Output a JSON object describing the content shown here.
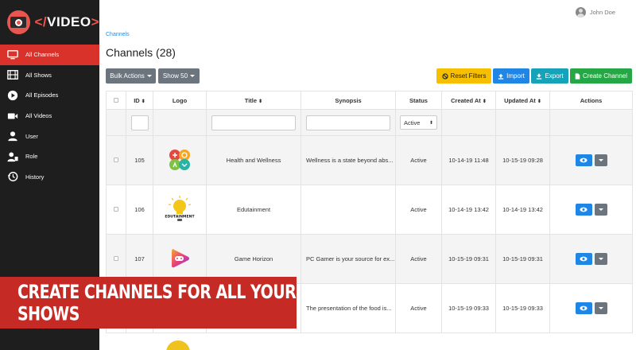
{
  "brand": {
    "logo_text_open": "</",
    "logo_text_word": "VIDEO",
    "logo_text_close": ">"
  },
  "sidebar": {
    "items": [
      {
        "label": "All Channels",
        "icon": "monitor-icon",
        "active": true
      },
      {
        "label": "All Shows",
        "icon": "film-icon"
      },
      {
        "label": "All Episodes",
        "icon": "play-circle-icon"
      },
      {
        "label": "All Videos",
        "icon": "video-camera-icon"
      },
      {
        "label": "User",
        "icon": "user-icon"
      },
      {
        "label": "Role",
        "icon": "user-tag-icon"
      },
      {
        "label": "History",
        "icon": "history-icon"
      }
    ]
  },
  "header": {
    "user_name": "John Doe"
  },
  "breadcrumb": "Channels",
  "page_title": "Channels (28)",
  "toolbar": {
    "bulk_actions": "Bulk Actions",
    "show_count": "Show 50",
    "reset_filters": "Reset Filters",
    "import": "Import",
    "export": "Export",
    "create_channel": "Create Channel"
  },
  "table": {
    "columns": [
      "",
      "ID",
      "Logo",
      "Title",
      "Synopsis",
      "Status",
      "Created At",
      "Updated At",
      "Actions"
    ],
    "filter_status": "Active",
    "rows": [
      {
        "id": "105",
        "title": "Health and Wellness",
        "synopsis": "Wellness is a state beyond abs...",
        "status": "Active",
        "created": "10-14-19 11:48",
        "updated": "10-15-19 09:28"
      },
      {
        "id": "106",
        "title": "Edutainment",
        "synopsis": "",
        "status": "Active",
        "created": "10-14-19 13:42",
        "updated": "10-14-19 13:42"
      },
      {
        "id": "107",
        "title": "Game Horizon",
        "synopsis": "PC Gamer is your source for ex...",
        "status": "Active",
        "created": "10-15-19 09:31",
        "updated": "10-15-19 09:31"
      },
      {
        "id": "",
        "title": "",
        "synopsis": "The presentation of the food is...",
        "status": "Active",
        "created": "10-15-19 09:33",
        "updated": "10-15-19 09:33"
      }
    ]
  },
  "banner_text": "CREATE CHANNELS FOR ALL YOUR SHOWS",
  "colors": {
    "sidebar_bg": "#1e1e1e",
    "accent_red": "#d8322b",
    "primary_blue": "#1f86e6"
  }
}
